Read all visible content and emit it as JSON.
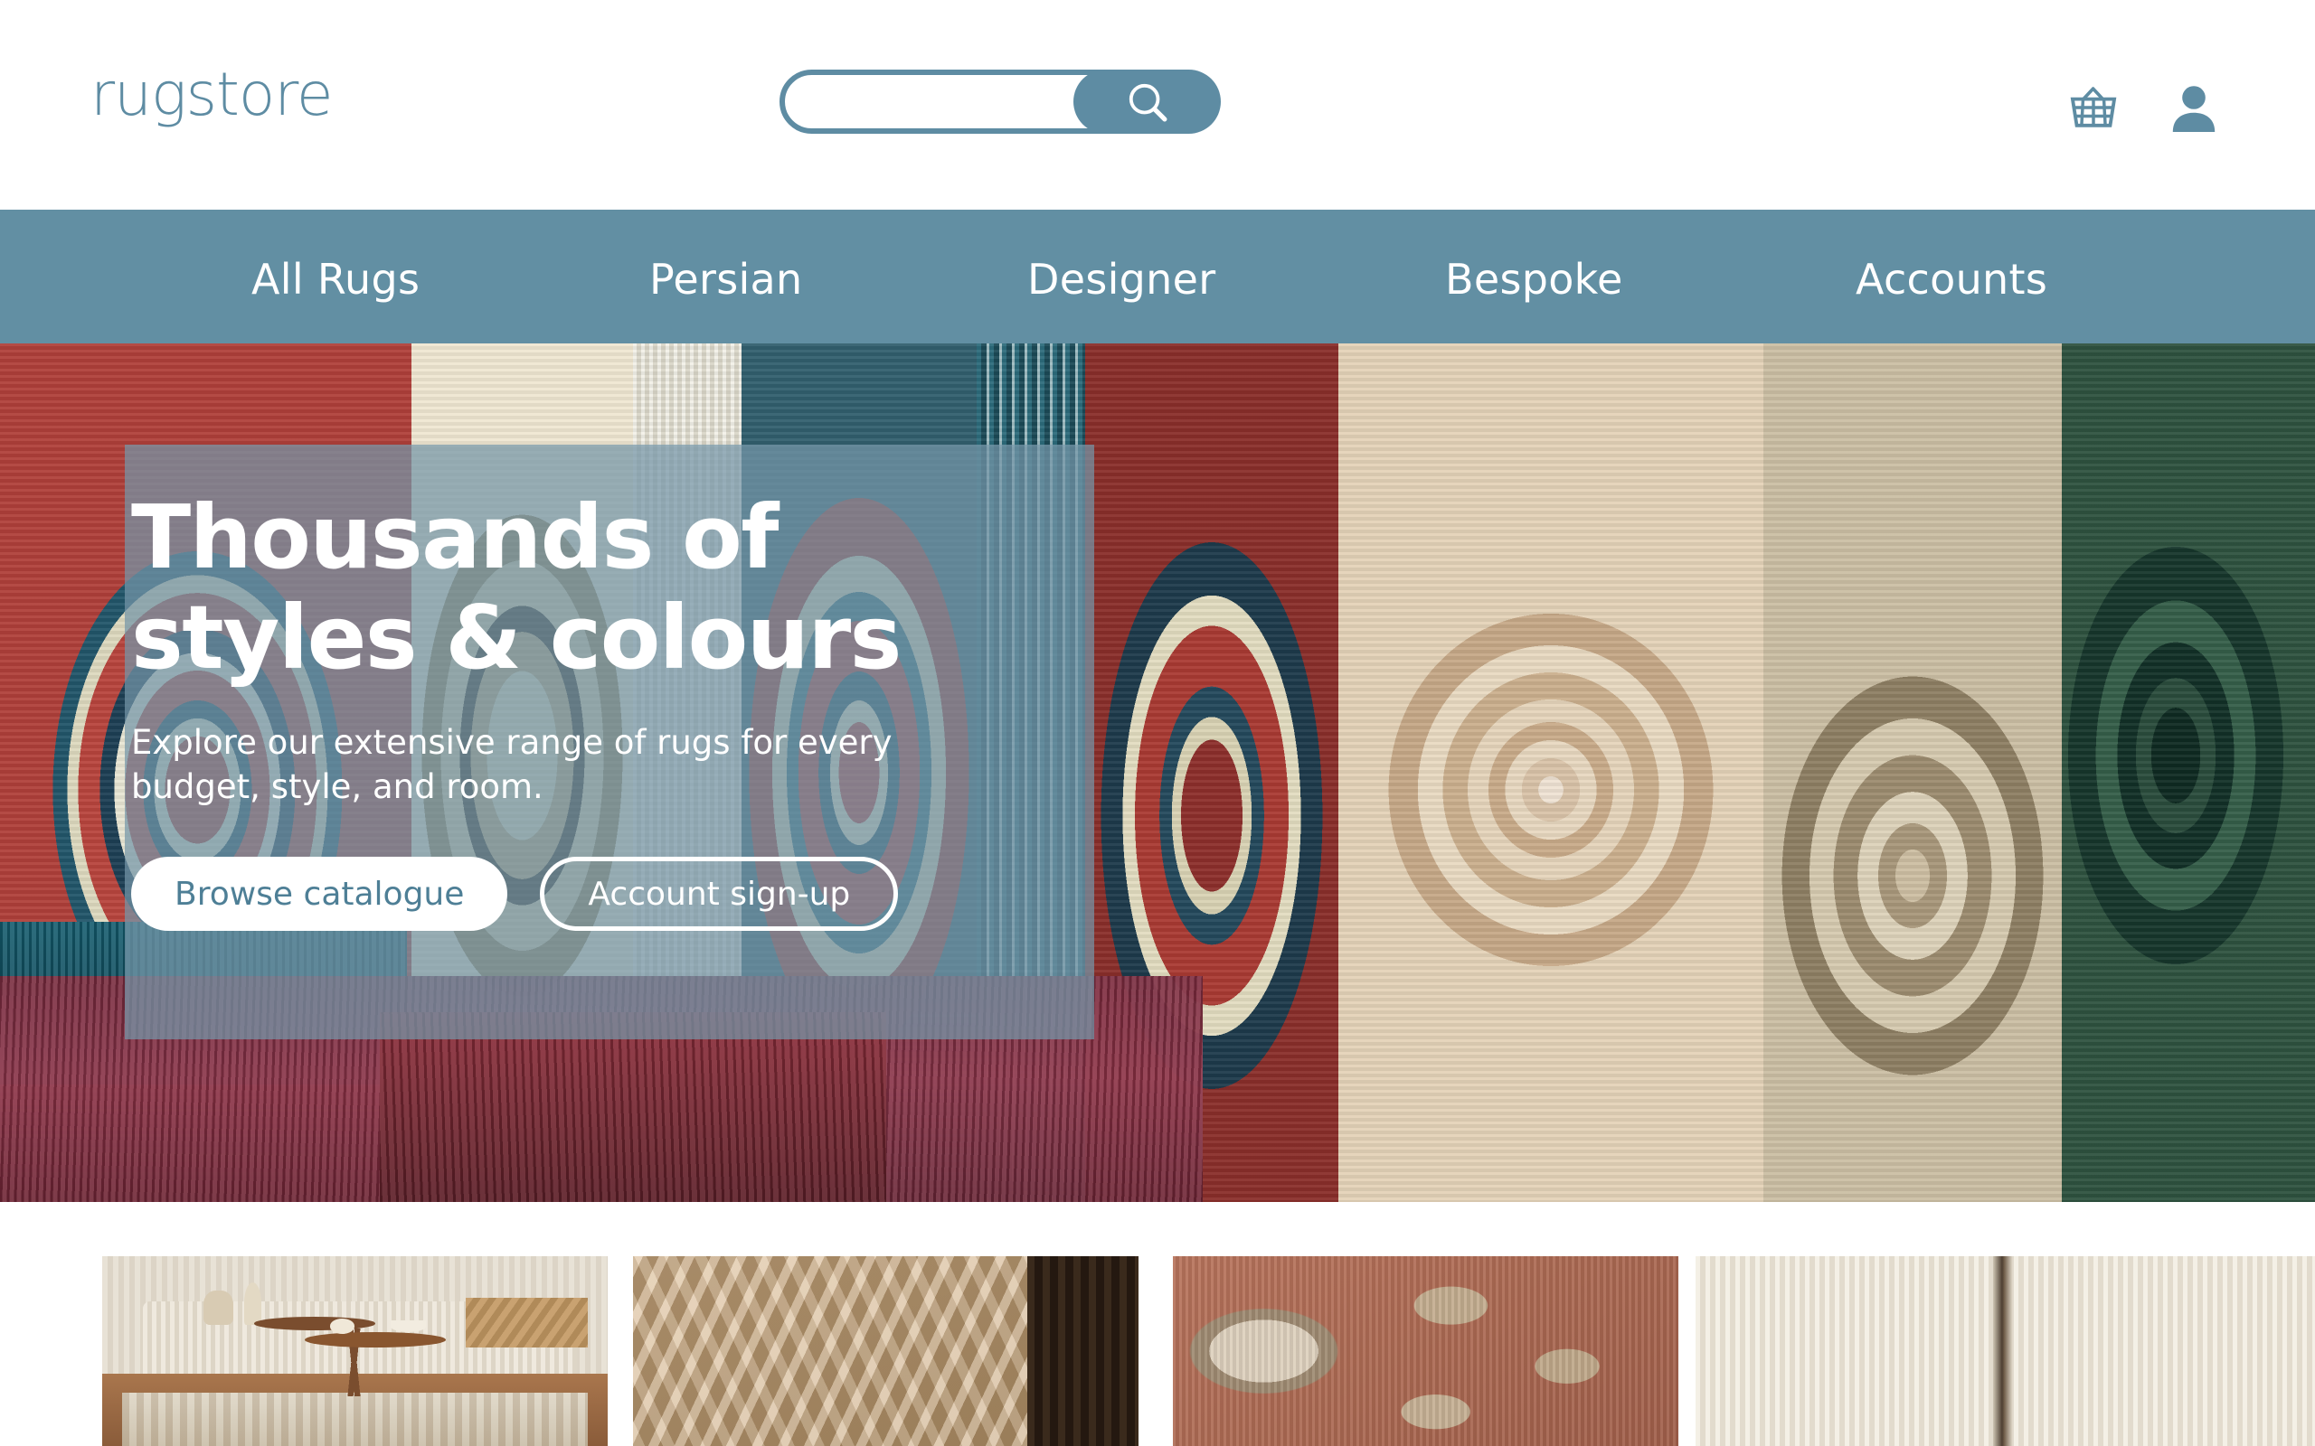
{
  "brand": {
    "logo_text": "rugstore",
    "accent_color": "#5E8CA3",
    "nav_bar_color": "#628FA3",
    "overlay_color": "rgba(117,150,168,0.72)"
  },
  "header": {
    "search": {
      "value": "",
      "placeholder": "",
      "button_icon": "search-icon"
    },
    "icons": [
      {
        "name": "basket-icon",
        "label": "Basket"
      },
      {
        "name": "account-icon",
        "label": "Account"
      }
    ]
  },
  "nav": {
    "items": [
      {
        "label": "All Rugs"
      },
      {
        "label": "Persian"
      },
      {
        "label": "Designer"
      },
      {
        "label": "Bespoke"
      },
      {
        "label": "Accounts"
      }
    ]
  },
  "hero": {
    "title_line1": "Thousands of",
    "title_line2": "styles & colours",
    "subtitle": "Explore our extensive range of rugs for every budget, style, and room.",
    "buttons": [
      {
        "label": "Browse catalogue",
        "style": "primary"
      },
      {
        "label": "Account sign-up",
        "style": "outline"
      }
    ]
  },
  "thumbnails": [
    {
      "name": "living-room-with-side-tables"
    },
    {
      "name": "chunky-knit-texture"
    },
    {
      "name": "terracotta-persian-rug"
    },
    {
      "name": "cream-ribbed-texture"
    }
  ]
}
